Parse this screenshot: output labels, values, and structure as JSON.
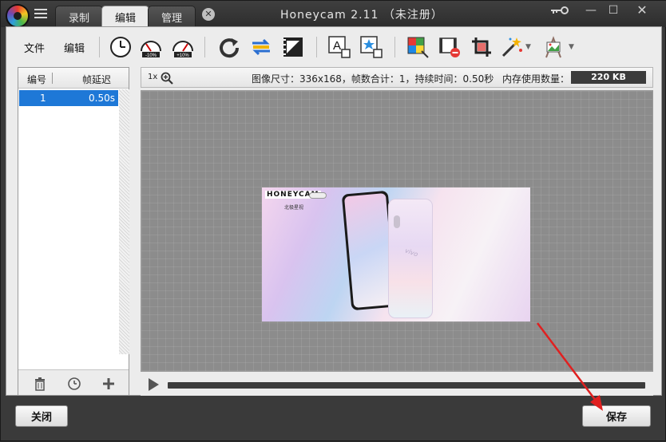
{
  "window": {
    "title": "Honeycam 2.11 （未注册）",
    "tabs": [
      {
        "label": "录制",
        "active": false
      },
      {
        "label": "编辑",
        "active": true
      },
      {
        "label": "管理",
        "active": false
      }
    ],
    "controls": [
      "key-icon",
      "minimize-icon",
      "maximize-icon",
      "close-icon"
    ]
  },
  "toolbar": {
    "file_label": "文件",
    "edit_label": "编辑",
    "speed_minus_label": "-10%",
    "speed_plus_label": "+10%",
    "icons": [
      "frame-delay-icon",
      "speed-down-icon",
      "speed-up-icon",
      "rotate-icon",
      "reverse-icon",
      "frame-edit-icon",
      "text-icon",
      "sticker-icon",
      "color-icon",
      "remove-frames-icon",
      "crop-icon",
      "effects-icon",
      "filter-icon"
    ]
  },
  "frames": {
    "col_number": "编号",
    "col_delay": "帧延迟",
    "rows": [
      {
        "number": "1",
        "delay": "0.50s"
      }
    ]
  },
  "canvas": {
    "zoom_label": "1x",
    "info": "图像尺寸：336x168，帧数合计：1，持续时间：0.50秒",
    "memory_label": "内存使用数量：",
    "memory_value": "220 KB",
    "preview": {
      "logo": "HONEYCAM",
      "subtitle": "北极星视",
      "brand": "vivo"
    }
  },
  "footer": {
    "close_label": "关闭",
    "save_label": "保存"
  },
  "colors": {
    "selection": "#1e78d7",
    "arrow": "#e02020"
  }
}
